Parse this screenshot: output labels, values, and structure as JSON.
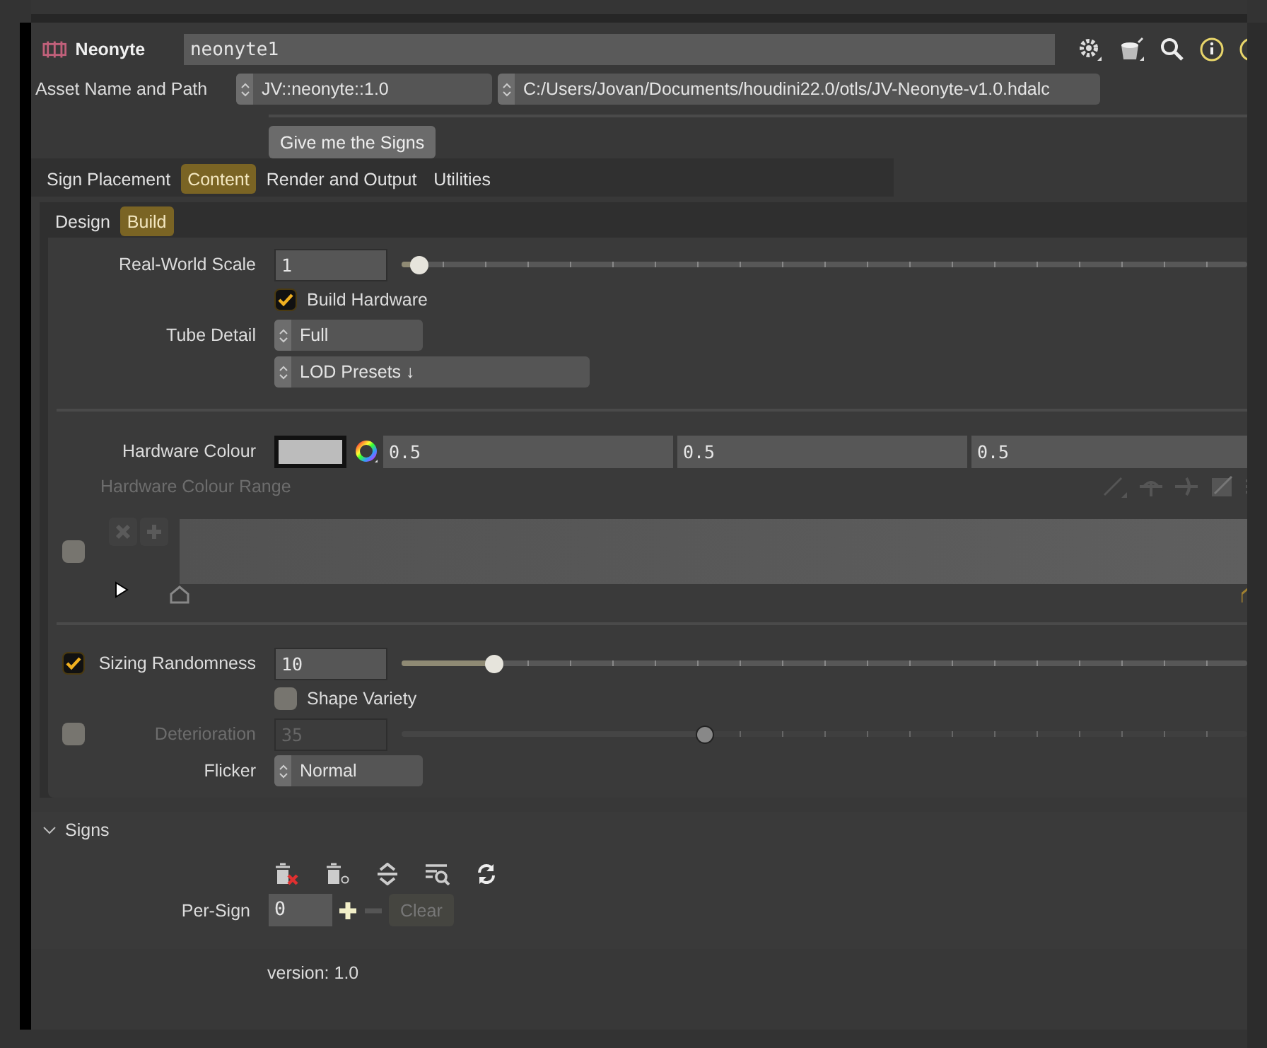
{
  "header": {
    "node_type": "Neonyte",
    "node_name": "neonyte1"
  },
  "asset": {
    "label": "Asset Name and Path",
    "name": "JV::neonyte::1.0",
    "path": "C:/Users/Jovan/Documents/houdini22.0/otls/JV-Neonyte-v1.0.hdalc"
  },
  "action_button": "Give me the Signs",
  "tabs": [
    {
      "label": "Sign Placement",
      "selected": false
    },
    {
      "label": "Content",
      "selected": true
    },
    {
      "label": "Render and Output",
      "selected": false
    },
    {
      "label": "Utilities",
      "selected": false
    }
  ],
  "subtabs": [
    {
      "label": "Design",
      "selected": false
    },
    {
      "label": "Build",
      "selected": true
    }
  ],
  "parms": [
    {
      "kind": "slider",
      "label": "Real-World Scale",
      "value": "1",
      "level": 0.016,
      "disabled": false
    },
    {
      "kind": "checkbox",
      "label": "Build Hardware",
      "checked": true
    },
    {
      "kind": "menu",
      "label": "Tube Detail",
      "value": "Full"
    },
    {
      "kind": "menu",
      "value": "LOD Presets ↓"
    },
    {
      "kind": "separator"
    },
    {
      "kind": "color",
      "label": "Hardware Colour",
      "values": [
        "0.5",
        "0.5",
        "0.5"
      ]
    },
    {
      "kind": "ramp",
      "label": "Hardware Colour Range",
      "disabled": true,
      "toggle": {
        "checked": false
      }
    },
    {
      "kind": "separator"
    },
    {
      "kind": "slider",
      "label": "Sizing Randomness",
      "value": "10",
      "level": 0.105,
      "disabled": false,
      "toggle": {
        "checked": true
      }
    },
    {
      "kind": "checkbox",
      "label": "Shape Variety",
      "checked": false
    },
    {
      "kind": "slider",
      "label": "Deterioration",
      "value": "35",
      "level": 0.355,
      "disabled": true,
      "toggle": {
        "checked": false
      }
    },
    {
      "kind": "menu",
      "label": "Flicker",
      "value": "Normal"
    }
  ],
  "signs_folder": {
    "title": "Signs",
    "expanded": true,
    "per_sign": {
      "label": "Per-Sign",
      "value": "0",
      "clear": "Clear"
    }
  },
  "version": "version: 1.0"
}
